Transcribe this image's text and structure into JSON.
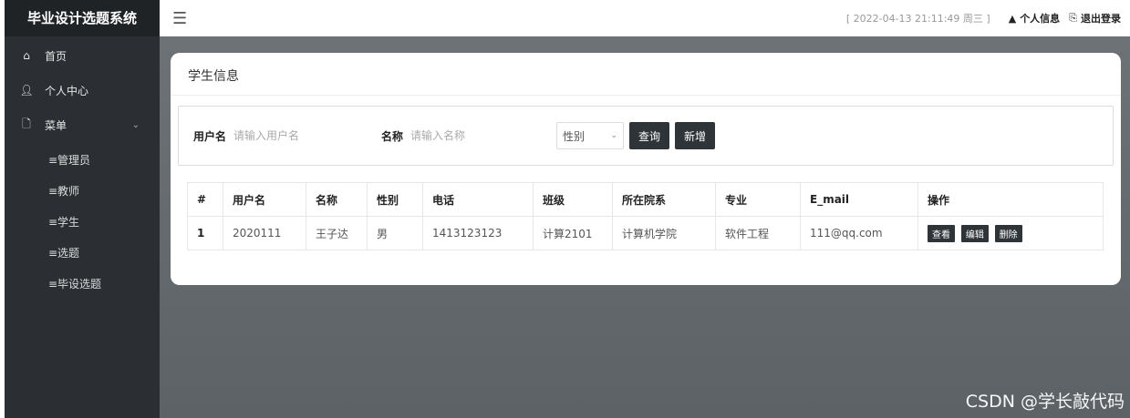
{
  "sidebar": {
    "brand": "毕业设计选题系统",
    "items": [
      {
        "label": "首页",
        "icon": "home-icon"
      },
      {
        "label": "个人中心",
        "icon": "user-icon"
      },
      {
        "label": "菜单",
        "icon": "document-icon"
      }
    ],
    "sub_items": [
      "≡管理员",
      "≡教师",
      "≡学生",
      "≡选题",
      "≡毕设选题"
    ]
  },
  "header": {
    "datetime": "[ 2022-04-13 21:11:49 周三 ]",
    "profile_label": "个人信息",
    "logout_label": "退出登录"
  },
  "card": {
    "title": "学生信息"
  },
  "search": {
    "username_label": "用户名",
    "username_placeholder": "请输入用户名",
    "name_label": "名称",
    "name_placeholder": "请输入名称",
    "gender_select": "性别",
    "query_button": "查询",
    "add_button": "新增"
  },
  "table": {
    "headers": [
      "#",
      "用户名",
      "名称",
      "性别",
      "电话",
      "班级",
      "所在院系",
      "专业",
      "E_mail",
      "操作"
    ],
    "rows": [
      {
        "num": "1",
        "username": "2020111",
        "name": "王子达",
        "gender": "男",
        "phone": "1413123123",
        "class": "计算2101",
        "department": "计算机学院",
        "major": "软件工程",
        "email": "111@qq.com"
      }
    ],
    "actions": [
      "查看",
      "编辑",
      "删除"
    ]
  },
  "watermark": "CSDN @学长敲代码"
}
